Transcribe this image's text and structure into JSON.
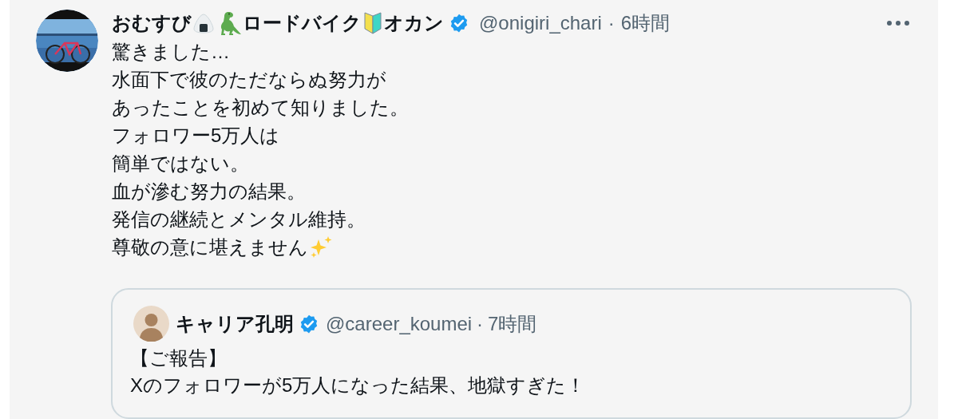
{
  "post": {
    "author": {
      "name_segments": [
        "おむすび",
        "ロードバイク",
        "オカン"
      ],
      "verified": true,
      "handle": "@onigiri_chari",
      "separator": "·",
      "time": "6時間"
    },
    "lines": [
      "驚きました…",
      "水面下で彼のただならぬ努力が",
      "あったことを初めて知りました。",
      "フォロワー5万人は",
      "簡単ではない。",
      "血が滲む努力の結果。",
      "発信の継続とメンタル維持。",
      "尊敬の意に堪えません"
    ],
    "quote": {
      "author": {
        "name": "キャリア孔明",
        "verified": true,
        "handle": "@career_koumei",
        "separator": "·",
        "time": "7時間"
      },
      "lines": [
        "【ご報告】",
        "Xのフォロワーが5万人になった結果、地獄すぎた！"
      ]
    }
  }
}
